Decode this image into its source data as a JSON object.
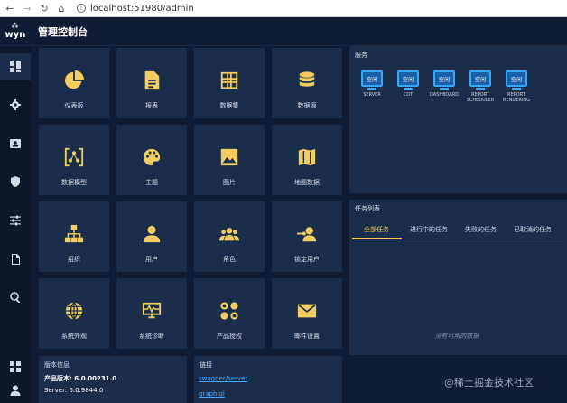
{
  "browser": {
    "url": "localhost:51980/admin"
  },
  "header": {
    "logo_text": "wyn",
    "title": "管理控制台"
  },
  "sidebar": {
    "items": [
      {
        "icon": "dashboard-grid-icon",
        "active": true
      },
      {
        "icon": "gear-icon",
        "active": false
      },
      {
        "icon": "id-card-icon",
        "active": false
      },
      {
        "icon": "shield-icon",
        "active": false
      },
      {
        "icon": "sliders-icon",
        "active": false
      },
      {
        "icon": "document-icon",
        "active": false
      },
      {
        "icon": "search-icon",
        "active": false
      },
      {
        "icon": "apps-grid-icon",
        "active": false
      },
      {
        "icon": "user-icon",
        "active": false
      }
    ]
  },
  "tiles": [
    {
      "label": "仪表板",
      "icon": "pie-chart-icon"
    },
    {
      "label": "报表",
      "icon": "report-file-icon"
    },
    {
      "label": "数据集",
      "icon": "table-grid-icon"
    },
    {
      "label": "数据源",
      "icon": "database-icon"
    },
    {
      "label": "数据模型",
      "icon": "data-model-icon"
    },
    {
      "label": "主题",
      "icon": "palette-icon"
    },
    {
      "label": "图片",
      "icon": "image-icon"
    },
    {
      "label": "地图数据",
      "icon": "map-icon"
    },
    {
      "label": "组织",
      "icon": "org-chart-icon"
    },
    {
      "label": "用户",
      "icon": "user-icon"
    },
    {
      "label": "角色",
      "icon": "users-group-icon"
    },
    {
      "label": "锁定用户",
      "icon": "locked-user-icon"
    },
    {
      "label": "系统外观",
      "icon": "globe-icon"
    },
    {
      "label": "系统诊断",
      "icon": "monitor-pulse-icon"
    },
    {
      "label": "产品授权",
      "icon": "license-icon"
    },
    {
      "label": "邮件设置",
      "icon": "mail-icon"
    }
  ],
  "services": {
    "title": "服务",
    "items": [
      {
        "status": "空闲",
        "label": "SERVER"
      },
      {
        "status": "空闲",
        "label": "COT"
      },
      {
        "status": "空闲",
        "label": "DASHBOARD"
      },
      {
        "status": "空闲",
        "label": "REPORT\nSCHEDULER"
      },
      {
        "status": "空闲",
        "label": "REPORT\nRENDERING"
      }
    ]
  },
  "tasks": {
    "title": "任务列表",
    "tabs": [
      "全部任务",
      "进行中的任务",
      "失败的任务",
      "已取消的任务"
    ],
    "active_tab": 0,
    "empty_text": "没有可用的数据"
  },
  "version": {
    "title": "版本信息",
    "product_version": "产品版本: 6.0.00231.0",
    "server_version": "Server: 6.0.9844.0"
  },
  "links": {
    "title": "链接",
    "items": [
      "swagger/server",
      "graphiql"
    ]
  },
  "watermark": "@稀土掘金技术社区",
  "colors": {
    "background": "#0f1c33",
    "tile": "#1a2d4b",
    "accent": "#f3cd5f",
    "service_blue": "#37a7ff",
    "link": "#4aa8ff"
  }
}
